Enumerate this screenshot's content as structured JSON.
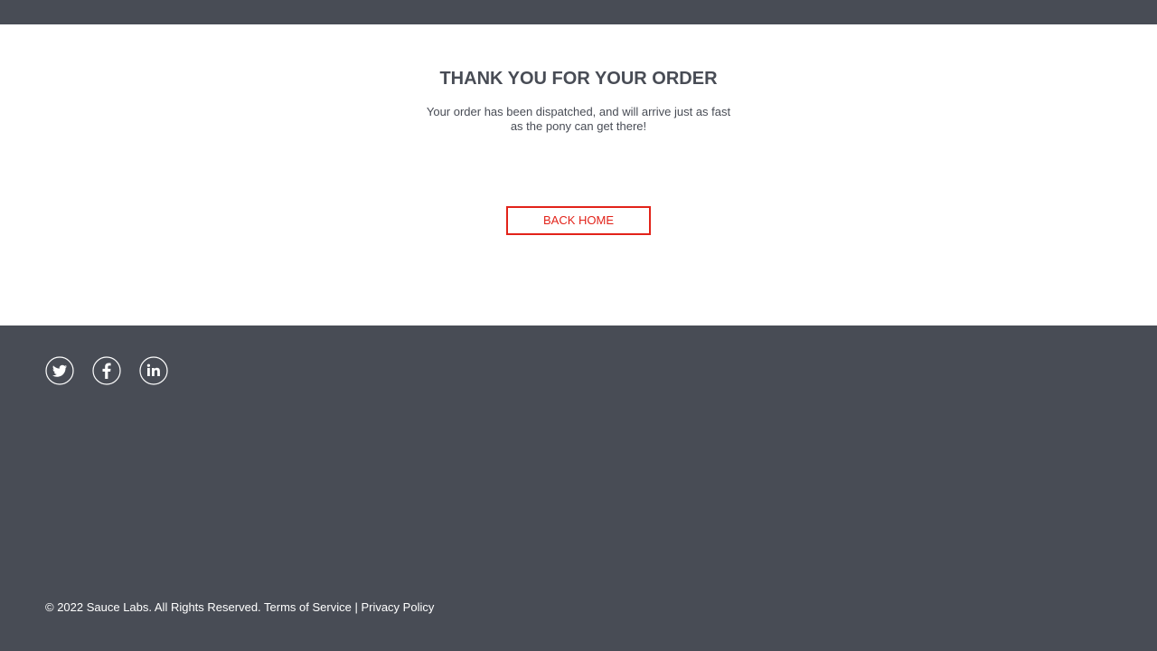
{
  "header": {},
  "checkout_complete": {
    "title": "THANK YOU FOR YOUR ORDER",
    "message": "Your order has been dispatched, and will arrive just as fast as the pony can get there!",
    "back_home_label": "BACK HOME"
  },
  "footer": {
    "social": [
      {
        "name": "twitter",
        "icon": "twitter-icon"
      },
      {
        "name": "facebook",
        "icon": "facebook-icon"
      },
      {
        "name": "linkedin",
        "icon": "linkedin-icon"
      }
    ],
    "copyright": "© 2022 Sauce Labs. All Rights Reserved. Terms of Service | Privacy Policy"
  },
  "colors": {
    "bar": "#484c55",
    "accent": "#e2231a",
    "text": "#484c55"
  }
}
